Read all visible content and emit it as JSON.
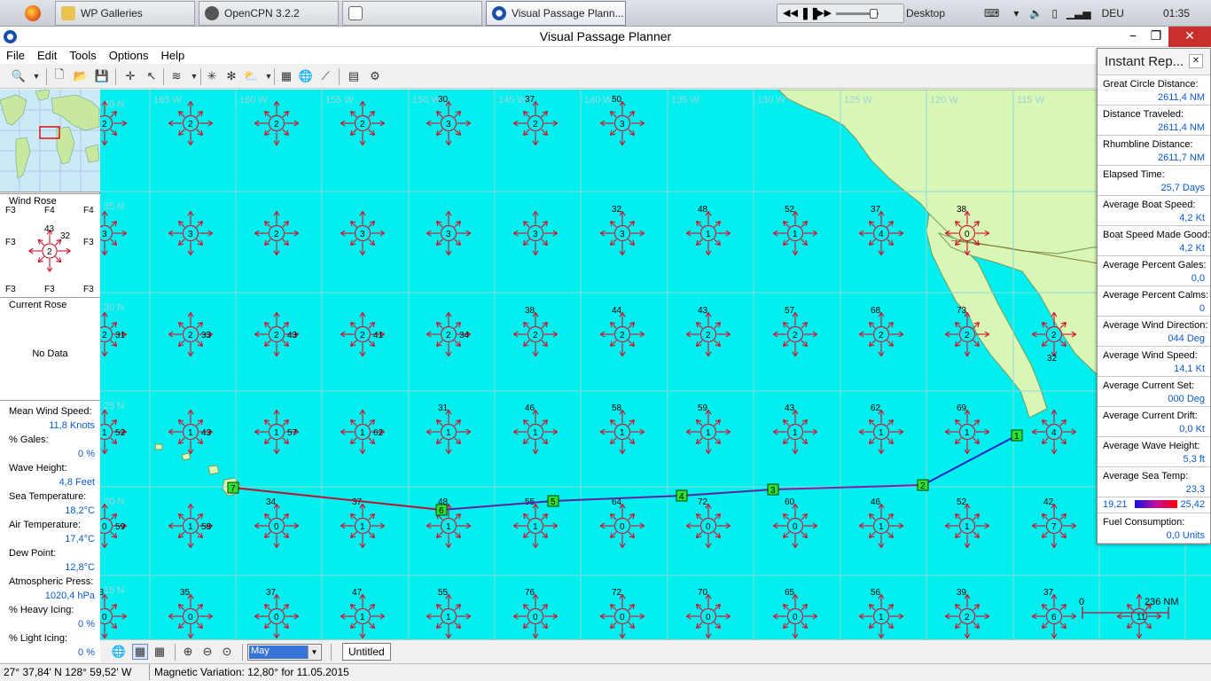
{
  "taskbar": {
    "buttons": [
      {
        "label": "WP Galleries"
      },
      {
        "label": "OpenCPN 3.2.2"
      },
      {
        "label": ""
      },
      {
        "label": "Visual Passage Plann..."
      }
    ],
    "desktop_label": "Desktop",
    "language": "DEU",
    "clock": "01:35"
  },
  "window": {
    "title": "Visual Passage Planner"
  },
  "menu": [
    "File",
    "Edit",
    "Tools",
    "Options",
    "Help"
  ],
  "left_panel": {
    "wind_rose": {
      "title": "Wind Rose",
      "force_labels": [
        "F3",
        "F4",
        "F4",
        "F3",
        "F3",
        "F3",
        "F3",
        "F3"
      ],
      "values": [
        "43",
        "32",
        "2"
      ]
    },
    "current_rose": {
      "title": "Current Rose",
      "message": "No Data"
    },
    "weather": [
      {
        "label": "Mean Wind Speed:",
        "value": "11,8 Knots"
      },
      {
        "label": "% Gales:",
        "value": "0 %"
      },
      {
        "label": "Wave Height:",
        "value": "4,8 Feet"
      },
      {
        "label": "Sea Temperature:",
        "value": "18,2°C"
      },
      {
        "label": "Air Temperature:",
        "value": "17,4°C"
      },
      {
        "label": "Dew Point:",
        "value": "12,8°C"
      },
      {
        "label": "Atmospheric Press:",
        "value": "1020,4 hPa"
      },
      {
        "label": "% Heavy Icing:",
        "value": "0 %"
      },
      {
        "label": "% Light Icing:",
        "value": "0 %"
      }
    ]
  },
  "map": {
    "longitude_labels": [
      "165 W",
      "160 W",
      "155 W",
      "150 W",
      "145 W",
      "140 W",
      "135 W",
      "130 W",
      "125 W",
      "120 W",
      "115 W",
      "110 W"
    ],
    "latitude_labels": [
      "40 N",
      "35 N",
      "30 N",
      "25 N",
      "20 N",
      "15 N"
    ],
    "rose_rows": [
      [
        {
          "v": "2"
        },
        {
          "v": "2"
        },
        {
          "v": "2"
        },
        {
          "v": "2"
        },
        {
          "v": "3",
          "t": "30"
        },
        {
          "v": "2",
          "t": "37"
        },
        {
          "v": "3",
          "t": "50"
        }
      ],
      [
        {
          "v": "3"
        },
        {
          "v": "3"
        },
        {
          "v": "2"
        },
        {
          "v": "3"
        },
        {
          "v": "3"
        },
        {
          "v": "3"
        },
        {
          "v": "3",
          "t": "32"
        },
        {
          "v": "1",
          "t": "48"
        },
        {
          "v": "1",
          "t": "52"
        },
        {
          "v": "4",
          "t": "37"
        },
        {
          "v": "0",
          "t": "38"
        }
      ],
      [
        {
          "v": "2",
          "r": "31"
        },
        {
          "v": "2",
          "r": "33"
        },
        {
          "v": "2",
          "r": "43"
        },
        {
          "v": "2",
          "r": "41"
        },
        {
          "v": "2",
          "r": "34"
        },
        {
          "v": "2",
          "t": "38"
        },
        {
          "v": "2",
          "t": "44"
        },
        {
          "v": "2",
          "t": "43"
        },
        {
          "v": "2",
          "t": "57"
        },
        {
          "v": "2",
          "t": "68"
        },
        {
          "v": "2",
          "t": "73"
        },
        {
          "v": "2",
          "b": "32"
        }
      ],
      [
        {
          "v": "1",
          "r": "52"
        },
        {
          "v": "1",
          "r": "43"
        },
        {
          "v": "1",
          "r": "57"
        },
        {
          "v": "1",
          "r": "62"
        },
        {
          "v": "1",
          "t": "31"
        },
        {
          "v": "1",
          "t": "46"
        },
        {
          "v": "1",
          "t": "58"
        },
        {
          "v": "1",
          "t": "59"
        },
        {
          "v": "1",
          "t": "43"
        },
        {
          "v": "1",
          "t": "62"
        },
        {
          "v": "1",
          "t": "69"
        },
        {
          "v": "4"
        }
      ],
      [
        {
          "v": "0",
          "r": "59"
        },
        {
          "v": "1",
          "r": "58"
        },
        {
          "v": "0",
          "t": "34"
        },
        {
          "v": "1",
          "t": "37"
        },
        {
          "v": "1",
          "t": "48"
        },
        {
          "v": "1",
          "t": "55"
        },
        {
          "v": "0",
          "t": "64"
        },
        {
          "v": "0",
          "t": "72"
        },
        {
          "v": "0",
          "t": "60"
        },
        {
          "v": "1",
          "t": "46"
        },
        {
          "v": "1",
          "t": "52"
        },
        {
          "v": "7",
          "t": "42"
        }
      ],
      [
        {
          "v": "0",
          "t": "43"
        },
        {
          "v": "0",
          "t": "35"
        },
        {
          "v": "0",
          "t": "37"
        },
        {
          "v": "1",
          "t": "47"
        },
        {
          "v": "1",
          "t": "55"
        },
        {
          "v": "0",
          "t": "76"
        },
        {
          "v": "0",
          "t": "72"
        },
        {
          "v": "0",
          "t": "70"
        },
        {
          "v": "0",
          "t": "65"
        },
        {
          "v": "1",
          "t": "56"
        },
        {
          "v": "2",
          "t": "39"
        },
        {
          "v": "6",
          "t": "37"
        },
        {
          "v": "11"
        }
      ]
    ],
    "waypoints": [
      "7",
      "6",
      "5",
      "4",
      "3",
      "2",
      "1"
    ],
    "scale_label": "236 NM",
    "scale_zero": "0"
  },
  "bottom": {
    "month": "May",
    "tab": "Untitled"
  },
  "status": {
    "position": "27° 37,84' N  128° 59,52' W",
    "magnetic": "Magnetic Variation: 12,80° for 11.05.2015"
  },
  "report": {
    "title": "Instant Rep...",
    "items": [
      {
        "label": "Great Circle Distance:",
        "value": "2611,4 NM"
      },
      {
        "label": "Distance Traveled:",
        "value": "2611,4 NM"
      },
      {
        "label": "Rhumbline Distance:",
        "value": "2611,7 NM"
      },
      {
        "label": "Elapsed Time:",
        "value": "25,7 Days"
      },
      {
        "label": "Average Boat Speed:",
        "value": "4,2 Kt"
      },
      {
        "label": "Boat Speed Made Good:",
        "value": "4,2 Kt"
      },
      {
        "label": "Average Percent Gales:",
        "value": "0,0"
      },
      {
        "label": "Average Percent Calms:",
        "value": "0"
      },
      {
        "label": "Average Wind Direction:",
        "value": "044 Deg"
      },
      {
        "label": "Average Wind Speed:",
        "value": "14,1 Kt"
      },
      {
        "label": "Average Current Set:",
        "value": "000 Deg"
      },
      {
        "label": "Average Current Drift:",
        "value": "0,0 Kt"
      },
      {
        "label": "Average Wave Height:",
        "value": "5,3 ft"
      },
      {
        "label": "Average Sea Temp:",
        "value": "23,3"
      }
    ],
    "temp_min": "19,21",
    "temp_max": "25,42",
    "fuel_label": "Fuel Consumption:",
    "fuel_value": "0,0 Units"
  },
  "colors": {
    "sea": "#00f0f0",
    "land": "#d8f6b4",
    "rose": "#d0102a",
    "route_a": "#c01030",
    "route_b": "#2222c8",
    "waypoint": "#30e030"
  }
}
